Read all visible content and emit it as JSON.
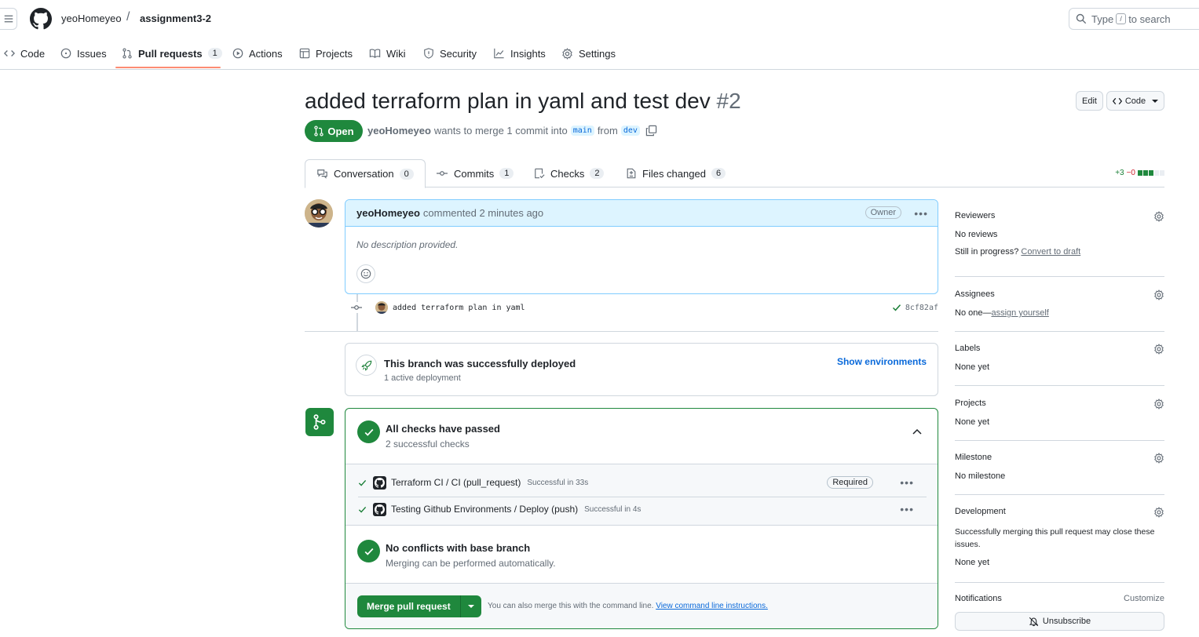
{
  "header": {
    "owner": "yeoHomeyeo",
    "separator": "/",
    "repo": "assignment3-2",
    "search_prefix": "Type",
    "search_key": "/",
    "search_suffix": "to search"
  },
  "repo_tabs": [
    {
      "label": "Code",
      "icon": "code-icon"
    },
    {
      "label": "Issues",
      "icon": "issue-icon"
    },
    {
      "label": "Pull requests",
      "icon": "pull-request-icon",
      "count": "1",
      "active": true
    },
    {
      "label": "Actions",
      "icon": "play-icon"
    },
    {
      "label": "Projects",
      "icon": "table-icon"
    },
    {
      "label": "Wiki",
      "icon": "book-icon"
    },
    {
      "label": "Security",
      "icon": "shield-icon"
    },
    {
      "label": "Insights",
      "icon": "graph-icon"
    },
    {
      "label": "Settings",
      "icon": "gear-icon"
    }
  ],
  "pr": {
    "title": "added terraform plan in yaml and test dev",
    "number": "#2",
    "edit_label": "Edit",
    "code_label": "Code",
    "state": "Open",
    "author": "yeoHomeyeo",
    "meta_text": "wants to merge 1 commit into",
    "base_branch": "main",
    "from_text": "from",
    "head_branch": "dev"
  },
  "pr_tabs": [
    {
      "label": "Conversation",
      "count": "0",
      "icon": "comment-discussion-icon"
    },
    {
      "label": "Commits",
      "count": "1",
      "icon": "commit-icon"
    },
    {
      "label": "Checks",
      "count": "2",
      "icon": "checklist-icon"
    },
    {
      "label": "Files changed",
      "count": "6",
      "icon": "file-diff-icon"
    }
  ],
  "diffstat": {
    "additions": "+3",
    "deletions": "−0"
  },
  "comment": {
    "author": "yeoHomeyeo",
    "action": "commented",
    "time": "2 minutes ago",
    "role": "Owner",
    "body": "No description provided."
  },
  "commit": {
    "message": "added terraform plan in yaml",
    "sha": "8cf82af"
  },
  "deployment": {
    "title": "This branch was successfully deployed",
    "subtitle": "1 active deployment",
    "action": "Show environments"
  },
  "checks": {
    "title": "All checks have passed",
    "subtitle": "2 successful checks",
    "items": [
      {
        "name": "Terraform CI / CI (pull_request)",
        "status": "Successful in 33s",
        "badge": "Required"
      },
      {
        "name": "Testing Github Environments / Deploy (push)",
        "status": "Successful in 4s",
        "badge": ""
      }
    ],
    "conflicts_title": "No conflicts with base branch",
    "conflicts_subtitle": "Merging can be performed automatically.",
    "merge_button": "Merge pull request",
    "merge_hint": "You can also merge this with the command line.",
    "merge_link": "View command line instructions."
  },
  "sidebar": {
    "reviewers": {
      "title": "Reviewers",
      "value": "No reviews",
      "note": "Still in progress?",
      "link": "Convert to draft"
    },
    "assignees": {
      "title": "Assignees",
      "value": "No one—",
      "link": "assign yourself"
    },
    "labels": {
      "title": "Labels",
      "value": "None yet"
    },
    "projects": {
      "title": "Projects",
      "value": "None yet"
    },
    "milestone": {
      "title": "Milestone",
      "value": "No milestone"
    },
    "development": {
      "title": "Development",
      "note": "Successfully merging this pull request may close these issues.",
      "value": "None yet"
    },
    "notifications": {
      "title": "Notifications",
      "customize": "Customize",
      "button": "Unsubscribe"
    }
  },
  "colors": {
    "accent_green": "#1f883d",
    "tab_underline": "#fd8c73",
    "link_blue": "#0969da",
    "comment_header": "#ddf4ff"
  }
}
